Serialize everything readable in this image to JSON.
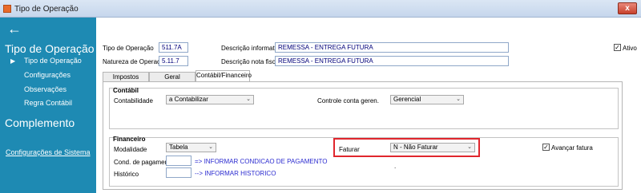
{
  "window": {
    "title": "Tipo de Operação",
    "close": "x"
  },
  "sidebar": {
    "heading": "Tipo de Operação",
    "items": [
      "Tipo de Operação",
      "Configurações",
      "Observações",
      "Regra Contábil"
    ],
    "section2": "Complemento",
    "link": "Configurações de Sistema"
  },
  "header": {
    "tipo_label": "Tipo de Operação",
    "tipo_value": "511.7A",
    "desc_info_label": "Descrição informativa",
    "desc_info_value": "REMESSA - ENTREGA FUTURA",
    "natureza_label": "Natureza de Operação",
    "natureza_value": "5.11.7",
    "desc_nota_label": "Descrição nota fiscal",
    "desc_nota_value": "REMESSA - ENTREGA FUTURA",
    "ativo_label": "Ativo",
    "ativo_checked": "✓"
  },
  "tabs": [
    "Impostos",
    "Geral",
    "Contábil/Financeiro"
  ],
  "contabil": {
    "title": "Contábil",
    "contabilidade_label": "Contabilidade",
    "contabilidade_value": "a Contabilizar",
    "controle_label": "Controle conta geren.",
    "controle_value": "Gerencial"
  },
  "financeiro": {
    "title": "Financeiro",
    "modalidade_label": "Modalidade",
    "modalidade_value": "Tabela",
    "faturar_label": "Faturar",
    "faturar_value": "N - Não Faturar",
    "avancar_label": "Avançar fatura",
    "avancar_checked": "✓",
    "cond_label": "Cond. de pagamento",
    "cond_link": "=> INFORMAR CONDICAO DE PAGAMENTO",
    "historico_label": "Histórico",
    "historico_link": "--> INFORMAR HISTORICO",
    "dot": "."
  }
}
